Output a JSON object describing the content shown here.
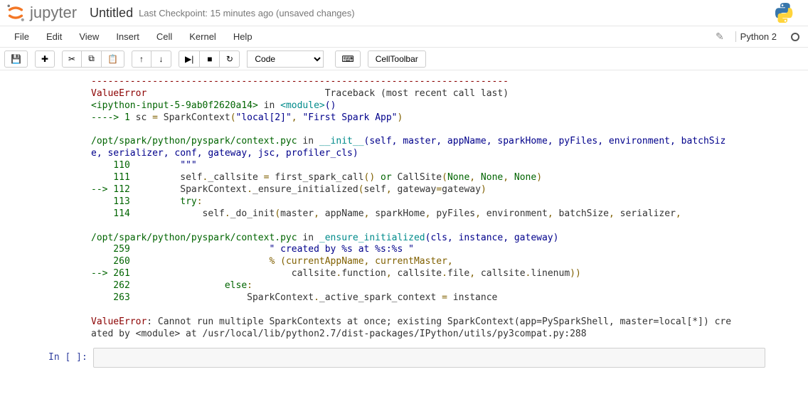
{
  "header": {
    "logo_text": "jupyter",
    "notebook_name": "Untitled",
    "checkpoint": "Last Checkpoint: 15 minutes ago (unsaved changes)"
  },
  "menubar": {
    "items": [
      "File",
      "Edit",
      "View",
      "Insert",
      "Cell",
      "Kernel",
      "Help"
    ],
    "kernel_name": "Python 2"
  },
  "toolbar": {
    "cell_type": "Code",
    "celltoolbar_label": "CellToolbar"
  },
  "output": {
    "divider": "---------------------------------------------------------------------------",
    "error_name": "ValueError",
    "traceback_label": "                                Traceback (most recent call last)",
    "line1_a": "<ipython-input-5-9ab0f2620a14>",
    "line1_b": " in ",
    "line1_c": "<module>",
    "line1_d": "()",
    "line2_a": "----> 1",
    "line2_b": " sc ",
    "line2_c": "=",
    "line2_d": " SparkContext",
    "line2_e": "(",
    "line2_f": "\"local[2]\"",
    "line2_g": ",",
    "line2_h": " ",
    "line2_i": "\"First Spark App\"",
    "line2_j": ")",
    "frame1_a": "/opt/spark/python/pyspark/context.pyc",
    "frame1_b": " in ",
    "frame1_c": "__init__",
    "frame1_d": "(self, master, appName, sparkHome, pyFiles, environment, batchSiz",
    "frame1_e": "e, serializer, conf, gateway, jsc, profiler_cls)",
    "l110_a": "    110",
    "l110_b": "         \"\"\"",
    "l111_a": "    111",
    "l111_b": "         self",
    "l111_c": ".",
    "l111_d": "_callsite ",
    "l111_e": "=",
    "l111_f": " first_spark_call",
    "l111_g": "()",
    "l111_h": " or",
    "l111_i": " CallSite",
    "l111_j": "(",
    "l111_k": "None",
    "l111_l": ",",
    "l111_m": " None",
    "l111_n": ",",
    "l111_o": " None",
    "l111_p": ")",
    "l112_a": "--> 112",
    "l112_b": "         SparkContext",
    "l112_c": ".",
    "l112_d": "_ensure_initialized",
    "l112_e": "(",
    "l112_f": "self",
    "l112_g": ",",
    "l112_h": " gateway",
    "l112_i": "=",
    "l112_j": "gateway",
    "l112_k": ")",
    "l113_a": "    113",
    "l113_b": "         try",
    "l113_c": ":",
    "l114_a": "    114",
    "l114_b": "             self",
    "l114_c": ".",
    "l114_d": "_do_init",
    "l114_e": "(",
    "l114_f": "master",
    "l114_g": ",",
    "l114_h": " appName",
    "l114_i": ",",
    "l114_j": " sparkHome",
    "l114_k": ",",
    "l114_l": " pyFiles",
    "l114_m": ",",
    "l114_n": " environment",
    "l114_o": ",",
    "l114_p": " batchSize",
    "l114_q": ",",
    "l114_r": " serializer",
    "l114_s": ",",
    "frame2_a": "/opt/spark/python/pyspark/context.pyc",
    "frame2_b": " in ",
    "frame2_c": "_ensure_initialized",
    "frame2_d": "(cls, instance, gateway)",
    "l259_a": "    259",
    "l259_b": "                         \" created by %s at %s:%s \"",
    "l260_a": "    260",
    "l260_b": "                         % (currentAppName, currentMaster,",
    "l261_a": "--> 261",
    "l261_b": "                             callsite",
    "l261_c": ".",
    "l261_d": "function",
    "l261_e": ",",
    "l261_f": " callsite",
    "l261_g": ".",
    "l261_h": "file",
    "l261_i": ",",
    "l261_j": " callsite",
    "l261_k": ".",
    "l261_l": "linenum",
    "l261_m": "))",
    "l262_a": "    262",
    "l262_b": "                 else",
    "l262_c": ":",
    "l263_a": "    263",
    "l263_b": "                     SparkContext",
    "l263_c": ".",
    "l263_d": "_active_spark_context ",
    "l263_e": "=",
    "l263_f": " instance",
    "final_a": "ValueError",
    "final_b": ": Cannot run multiple SparkContexts at once; existing SparkContext(app=PySparkShell, master=local[*]) cre",
    "final_c": "ated by <module> at /usr/local/lib/python2.7/dist-packages/IPython/utils/py3compat.py:288"
  },
  "input_prompt": "In [ ]:"
}
